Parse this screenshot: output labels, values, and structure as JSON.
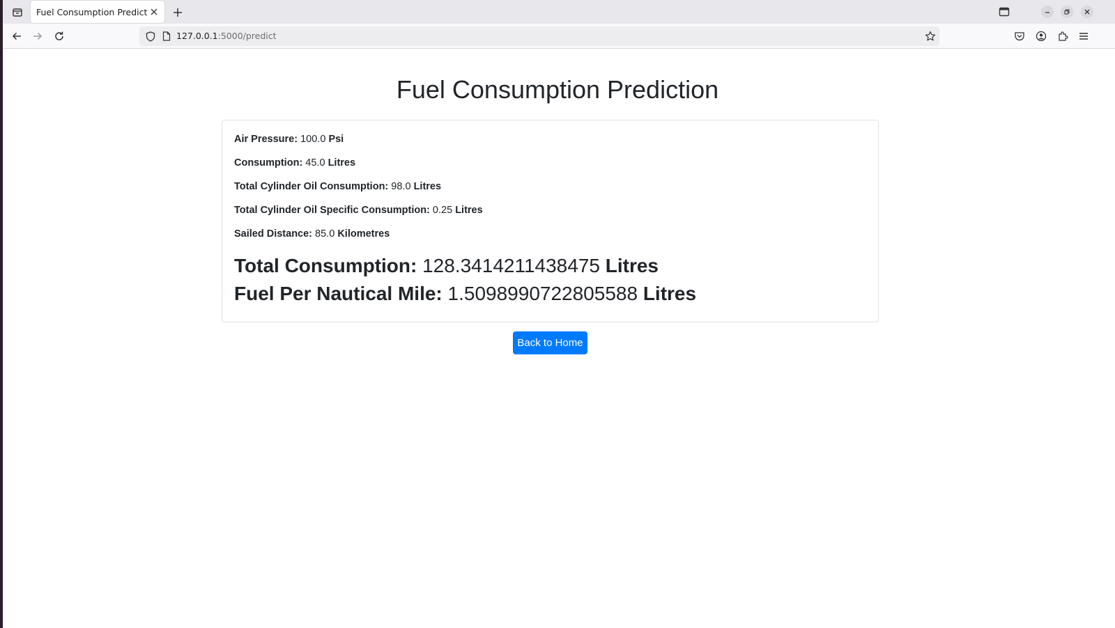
{
  "browser": {
    "tab_title": "Fuel Consumption Prediction",
    "url_host": "127.0.0.1",
    "url_rest": ":5000/predict"
  },
  "page": {
    "title": "Fuel Consumption Prediction",
    "inputs": [
      {
        "label": "Air Pressure:",
        "value": "100.0",
        "unit": "Psi"
      },
      {
        "label": "Consumption:",
        "value": "45.0",
        "unit": "Litres"
      },
      {
        "label": "Total Cylinder Oil Consumption:",
        "value": "98.0",
        "unit": "Litres"
      },
      {
        "label": "Total Cylinder Oil Specific Consumption:",
        "value": "0.25",
        "unit": "Litres"
      },
      {
        "label": "Sailed Distance:",
        "value": "85.0",
        "unit": "Kilometres"
      }
    ],
    "results": [
      {
        "label": "Total Consumption:",
        "value": "128.3414211438475",
        "unit": "Litres"
      },
      {
        "label": "Fuel Per Nautical Mile:",
        "value": "1.5098990722805588",
        "unit": "Litres"
      }
    ],
    "back_button": "Back to Home"
  },
  "colors": {
    "primary_button": "#007bff",
    "text": "#212529",
    "card_border": "#dfe1e4"
  }
}
